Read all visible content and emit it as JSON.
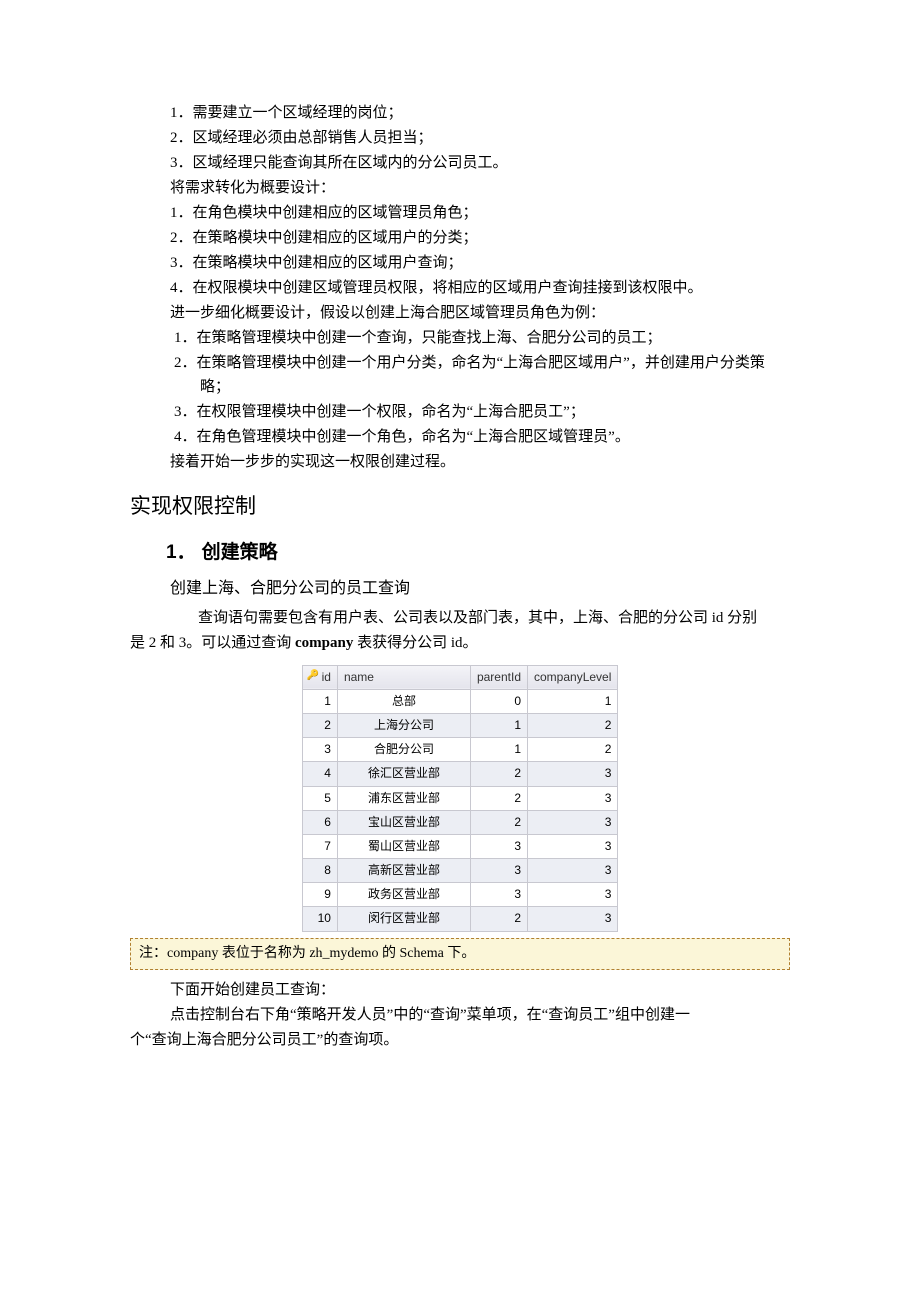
{
  "req": {
    "l1": "1．需要建立一个区域经理的岗位；",
    "l2": "2．区域经理必须由总部销售人员担当；",
    "l3": "3．区域经理只能查询其所在区域内的分公司员工。",
    "trans": "将需求转化为概要设计：",
    "d1": "1．在角色模块中创建相应的区域管理员角色；",
    "d2": "2．在策略模块中创建相应的区域用户的分类；",
    "d3": "3．在策略模块中创建相应的区域用户查询；",
    "d4": "4．在权限模块中创建区域管理员权限，将相应的区域用户查询挂接到该权限中。",
    "refine": "进一步细化概要设计，假设以创建上海合肥区域管理员角色为例：",
    "r1": "1．在策略管理模块中创建一个查询，只能查找上海、合肥分公司的员工；",
    "r2": "2．在策略管理模块中创建一个用户分类，命名为“上海合肥区域用户”，并创建用户分类策略；",
    "r3": "3．在权限管理模块中创建一个权限，命名为“上海合肥员工”；",
    "r4": "4．在角色管理模块中创建一个角色，命名为“上海合肥区域管理员”。",
    "next": "接着开始一步步的实现这一权限创建过程。"
  },
  "sec_impl": "实现权限控制",
  "sub1": {
    "num": "1．",
    "title": "创建策略"
  },
  "subtitle1": "创建上海、合肥分公司的员工查询",
  "para1a": "查询语句需要包含有用户表、公司表以及部门表，其中，上海、合肥的分公司 id 分别",
  "para1b_pre": "是 2 和 3。可以通过查询 ",
  "para1b_bold": "company",
  "para1b_post": " 表获得分公司 id。",
  "table": {
    "headers": {
      "id": "id",
      "name": "name",
      "parentId": "parentId",
      "companyLevel": "companyLevel"
    },
    "rows": [
      {
        "id": "1",
        "name": "总部",
        "parentId": "0",
        "companyLevel": "1"
      },
      {
        "id": "2",
        "name": "上海分公司",
        "parentId": "1",
        "companyLevel": "2"
      },
      {
        "id": "3",
        "name": "合肥分公司",
        "parentId": "1",
        "companyLevel": "2"
      },
      {
        "id": "4",
        "name": "徐汇区营业部",
        "parentId": "2",
        "companyLevel": "3"
      },
      {
        "id": "5",
        "name": "浦东区营业部",
        "parentId": "2",
        "companyLevel": "3"
      },
      {
        "id": "6",
        "name": "宝山区营业部",
        "parentId": "2",
        "companyLevel": "3"
      },
      {
        "id": "7",
        "name": "蜀山区营业部",
        "parentId": "3",
        "companyLevel": "3"
      },
      {
        "id": "8",
        "name": "高新区营业部",
        "parentId": "3",
        "companyLevel": "3"
      },
      {
        "id": "9",
        "name": "政务区营业部",
        "parentId": "3",
        "companyLevel": "3"
      },
      {
        "id": "10",
        "name": "闵行区营业部",
        "parentId": "2",
        "companyLevel": "3"
      }
    ]
  },
  "note": "注：company 表位于名称为 zh_mydemo 的 Schema 下。",
  "para2": "下面开始创建员工查询：",
  "para3a": "点击控制台右下角“策略开发人员”中的“查询”菜单项，在“查询员工”组中创建一",
  "para3b": "个“查询上海合肥分公司员工”的查询项。"
}
